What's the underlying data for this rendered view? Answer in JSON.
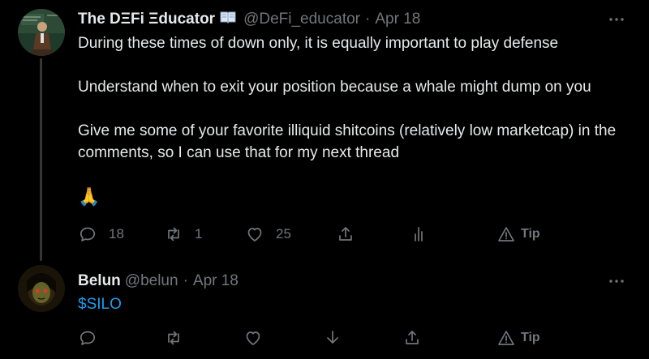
{
  "tweet_main": {
    "display_name": "The DΞFi Ξducator",
    "badge_icon": "book-emoji",
    "handle": "@DeFi_educator",
    "separator": "·",
    "date": "Apr 18",
    "text_lines": [
      "During these times of down only, it is equally important to play defense",
      "Understand when to exit your position because a whale might dump on you",
      "Give me some of your favorite illiquid shitcoins (relatively low marketcap) in the comments, so I can use that for my next thread"
    ],
    "emoji": "🙏",
    "actions": {
      "reply_count": "18",
      "retweet_count": "1",
      "like_count": "25",
      "tip_label": "Tip"
    }
  },
  "tweet_reply": {
    "display_name": "Belun",
    "handle": "@belun",
    "separator": "·",
    "date": "Apr 18",
    "text": "$SILO",
    "actions": {
      "tip_label": "Tip"
    }
  },
  "colors": {
    "background": "#000000",
    "text": "#e7e9ea",
    "secondary": "#71767b",
    "link": "#1d9bf0",
    "thread_line": "#333639"
  }
}
